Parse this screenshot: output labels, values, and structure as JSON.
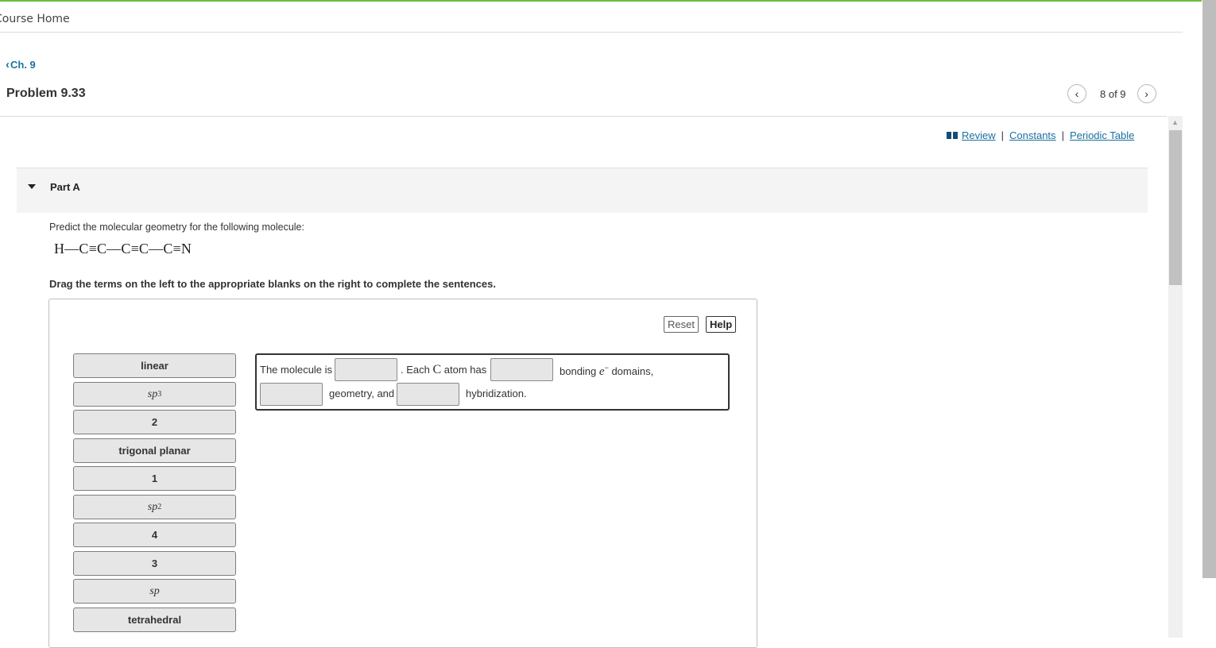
{
  "header": {
    "course_home": "Course Home"
  },
  "nav": {
    "back_label": "Ch. 9",
    "problem_title": "Problem 9.33",
    "pager_text": "8 of 9"
  },
  "resources": {
    "review": "Review",
    "constants": "Constants",
    "periodic_table": "Periodic Table",
    "separator": "|"
  },
  "part": {
    "title": "Part A",
    "prompt": "Predict the molecular geometry for the following molecule:",
    "molecule": "H—C≡C—C≡C—C≡N",
    "instruction": "Drag the terms on the left to the appropriate blanks on the right to complete the sentences."
  },
  "toolbar": {
    "reset_label": "Reset",
    "help_label": "Help"
  },
  "terms": [
    {
      "label": "linear"
    },
    {
      "base": "sp",
      "sup": "3"
    },
    {
      "label": "2"
    },
    {
      "label": "trigonal planar"
    },
    {
      "label": "1"
    },
    {
      "base": "sp",
      "sup": "2"
    },
    {
      "label": "4"
    },
    {
      "label": "3"
    },
    {
      "base": "sp",
      "sup": ""
    },
    {
      "label": "tetrahedral"
    }
  ],
  "sentence": {
    "part1": "The molecule is",
    "part2a": ". Each ",
    "part2_atom": "C",
    "part2b": " atom has",
    "part3": "bonding",
    "part3_e": "e",
    "part3_minus": "−",
    "part3b": " domains,",
    "part4": "geometry, and",
    "part5": "hybridization."
  }
}
